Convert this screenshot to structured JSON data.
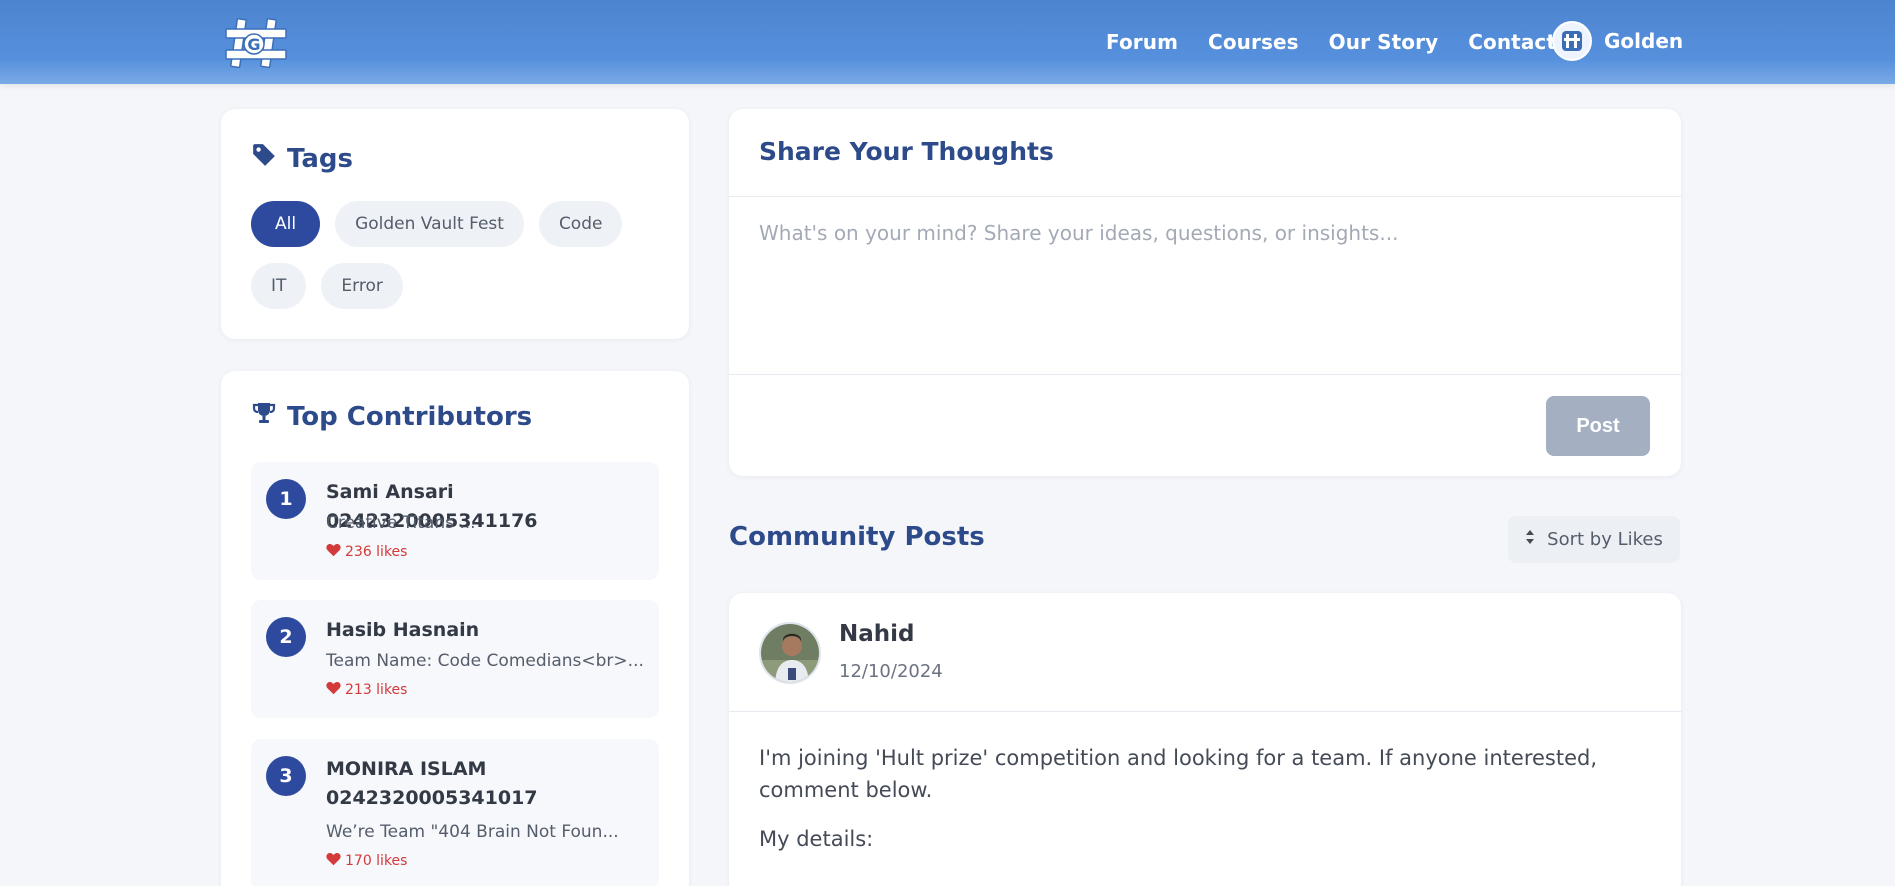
{
  "header": {
    "logo_alt": "G",
    "nav": [
      "Forum",
      "Courses",
      "Our Story",
      "Contact"
    ],
    "user": {
      "name": "Golden"
    }
  },
  "tags": {
    "title": "Tags",
    "items": [
      {
        "label": "All",
        "active": true
      },
      {
        "label": "Golden Vault Fest",
        "active": false
      },
      {
        "label": "Code",
        "active": false
      },
      {
        "label": "IT",
        "active": false
      },
      {
        "label": "Error",
        "active": false
      }
    ]
  },
  "contributors": {
    "title": "Top Contributors",
    "items": [
      {
        "rank": "1",
        "name": "Sami Ansari 0242320005341176",
        "desc": "Creative Titans ...",
        "likes": "236 likes"
      },
      {
        "rank": "2",
        "name": "Hasib Hasnain",
        "desc": "Team Name: Code Comedians<br>...",
        "likes": "213 likes"
      },
      {
        "rank": "3",
        "name": "MONIRA ISLAM 0242320005341017",
        "desc": "We’re Team \"404 Brain Not Foun...",
        "likes": "170 likes"
      }
    ]
  },
  "share": {
    "title": "Share Your Thoughts",
    "placeholder": "What's on your mind? Share your ideas, questions, or insights...",
    "post_label": "Post"
  },
  "community": {
    "title": "Community Posts",
    "sort_label": "Sort by Likes"
  },
  "post": {
    "author": "Nahid",
    "date": "12/10/2024",
    "body": "I'm joining 'Hult prize' competition and looking for a team. If anyone interested, comment below.",
    "details": "My details:"
  },
  "colors": {
    "header": "#5690dc",
    "primary": "#2d4a9e",
    "heading": "#2d4a8a",
    "like": "#d33a3a"
  }
}
